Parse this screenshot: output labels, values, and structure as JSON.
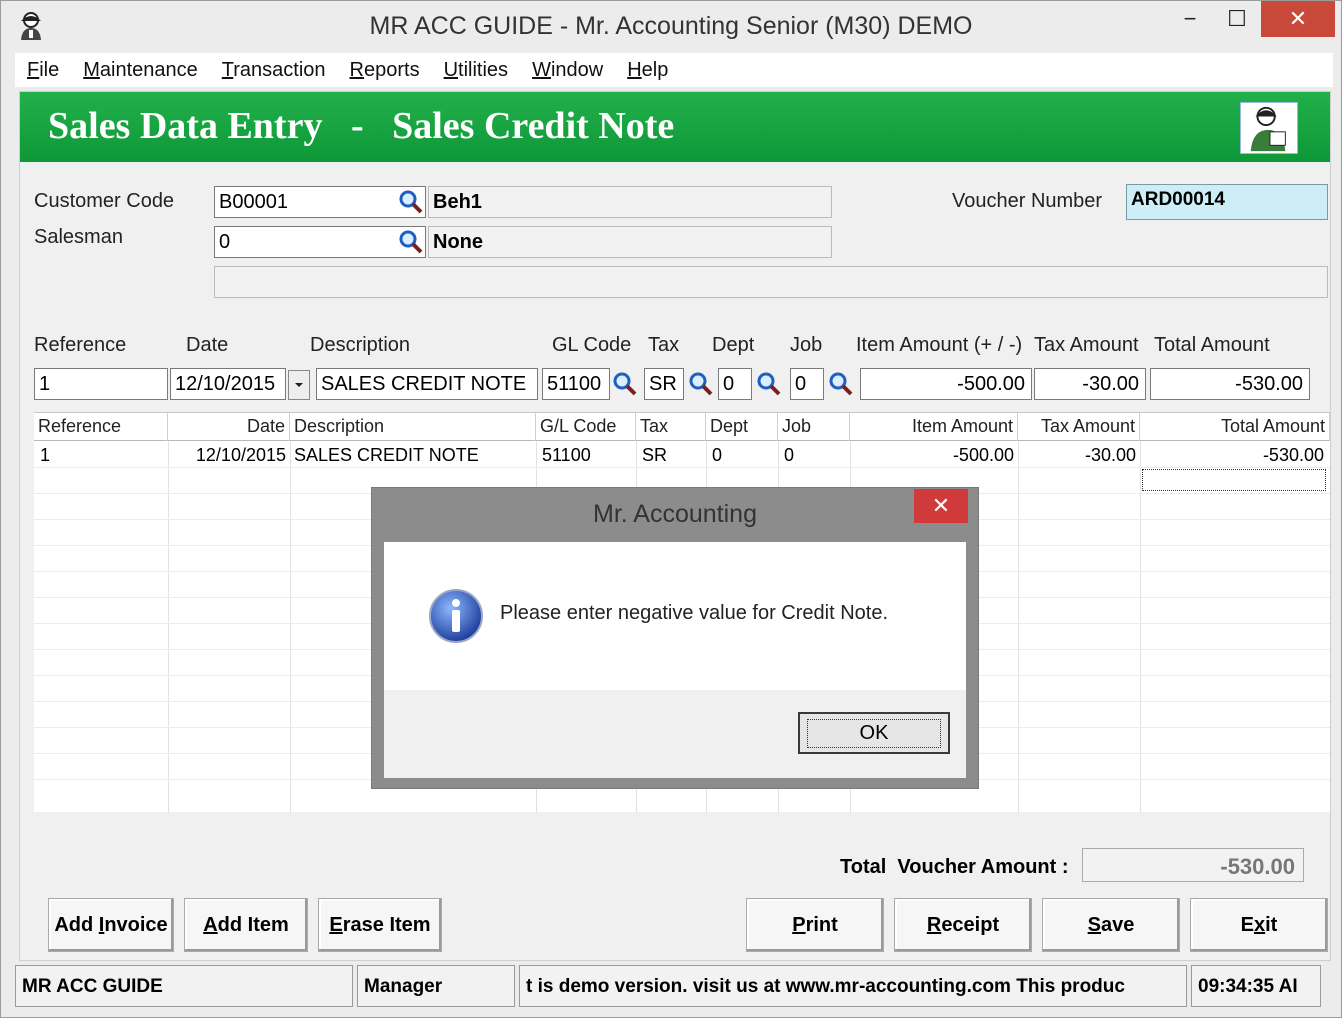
{
  "window": {
    "title": "MR ACC GUIDE - Mr. Accounting Senior (M30) DEMO",
    "controls": {
      "minimize": "−",
      "maximize": "☐",
      "close": "✕"
    }
  },
  "menu": [
    {
      "label": "File",
      "accel": "F",
      "rest": "ile"
    },
    {
      "label": "Maintenance",
      "accel": "M",
      "rest": "aintenance"
    },
    {
      "label": "Transaction",
      "accel": "T",
      "rest": "ransaction"
    },
    {
      "label": "Reports",
      "accel": "R",
      "rest": "eports"
    },
    {
      "label": "Utilities",
      "accel": "U",
      "rest": "tilities"
    },
    {
      "label": "Window",
      "accel": "W",
      "rest": "indow"
    },
    {
      "label": "Help",
      "accel": "H",
      "rest": "elp"
    }
  ],
  "header": {
    "title": "Sales Data Entry   -   Sales Credit Note"
  },
  "form": {
    "customer_code_label": "Customer Code",
    "customer_code": "B00001",
    "customer_name": "Beh1",
    "salesman_label": "Salesman",
    "salesman": "0",
    "salesman_name": "None",
    "voucher_number_label": "Voucher Number",
    "voucher_number": "ARD00014"
  },
  "entry": {
    "headers": {
      "reference": "Reference",
      "date": "Date",
      "description": "Description",
      "gl_code": "GL Code",
      "tax": "Tax",
      "dept": "Dept",
      "job": "Job",
      "item_amount": "Item Amount (+ / -)",
      "tax_amount": "Tax Amount",
      "total_amount": "Total Amount"
    },
    "values": {
      "reference": "1",
      "date": "12/10/2015",
      "description": "SALES CREDIT NOTE",
      "gl_code": "51100",
      "tax": "SR",
      "dept": "0",
      "job": "0",
      "item_amount": "-500.00",
      "tax_amount": "-30.00",
      "total_amount": "-530.00"
    }
  },
  "grid": {
    "columns": [
      "Reference",
      "Date",
      "Description",
      "G/L Code",
      "Tax",
      "Dept",
      "Job",
      "Item Amount",
      "Tax Amount",
      "Total Amount"
    ],
    "rows": [
      [
        "1",
        "12/10/2015",
        "SALES CREDIT NOTE",
        "51100",
        "SR",
        "0",
        "0",
        "-500.00",
        "-30.00",
        "-530.00"
      ]
    ]
  },
  "dialog": {
    "title": "Mr. Accounting",
    "message": "Please enter negative value for Credit Note.",
    "ok_label": "OK",
    "close": "✕"
  },
  "totals": {
    "label": "Total  Voucher Amount :",
    "value": "-530.00"
  },
  "buttons": {
    "add_invoice": {
      "pre": "Add ",
      "accel": "I",
      "post": "nvoice"
    },
    "add_item": {
      "pre": "",
      "accel": "A",
      "post": "dd Item"
    },
    "erase_item": {
      "pre": "",
      "accel": "E",
      "post": "rase Item"
    },
    "print": {
      "pre": "",
      "accel": "P",
      "post": "rint"
    },
    "receipt": {
      "pre": "",
      "accel": "R",
      "post": "eceipt"
    },
    "save": {
      "pre": "",
      "accel": "S",
      "post": "ave"
    },
    "exit": {
      "pre": "E",
      "accel": "x",
      "post": "it"
    }
  },
  "status": {
    "company": "MR ACC GUIDE",
    "user": "Manager",
    "marquee": "t is demo version.  visit us at www.mr-accounting.com This produc",
    "time": "09:34:35 AI"
  },
  "colors": {
    "header_green": "#129c3c",
    "voucher_bg": "#cdeef6",
    "close_red": "#c9493a"
  }
}
